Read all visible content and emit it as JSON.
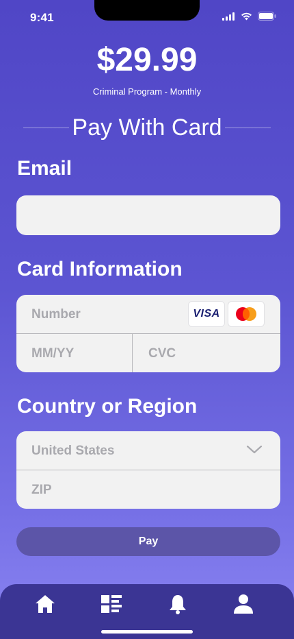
{
  "status_bar": {
    "time": "9:41",
    "icons": [
      "signal-icon",
      "wifi-icon",
      "battery-icon"
    ]
  },
  "header": {
    "price": "$29.99",
    "program": "Criminal Program - Monthly",
    "title": "Pay With Card"
  },
  "email": {
    "label": "Email",
    "value": "",
    "placeholder": ""
  },
  "card": {
    "label": "Card Information",
    "number_placeholder": "Number",
    "expiry_placeholder": "MM/YY",
    "cvc_placeholder": "CVC",
    "brand_logos": [
      "visa-logo",
      "mastercard-logo"
    ],
    "visa_text": "VISA"
  },
  "country": {
    "label": "Country or Region",
    "selected": "United States",
    "zip_placeholder": "ZIP"
  },
  "pay_button": {
    "label": "Pay"
  },
  "tab_bar": {
    "tabs": [
      "home-icon",
      "list-icon",
      "bell-icon",
      "profile-icon"
    ]
  },
  "colors": {
    "background_top": "#5046c6",
    "background_bottom": "#8a84f2",
    "field_background": "#f2f2f2",
    "placeholder_text": "#a9a9ae",
    "pay_button": "#5c55a8",
    "tab_bar": "#3b3594",
    "mastercard_red": "#eb001b",
    "mastercard_orange": "#f79e1b",
    "visa_blue": "#1a1f71"
  }
}
